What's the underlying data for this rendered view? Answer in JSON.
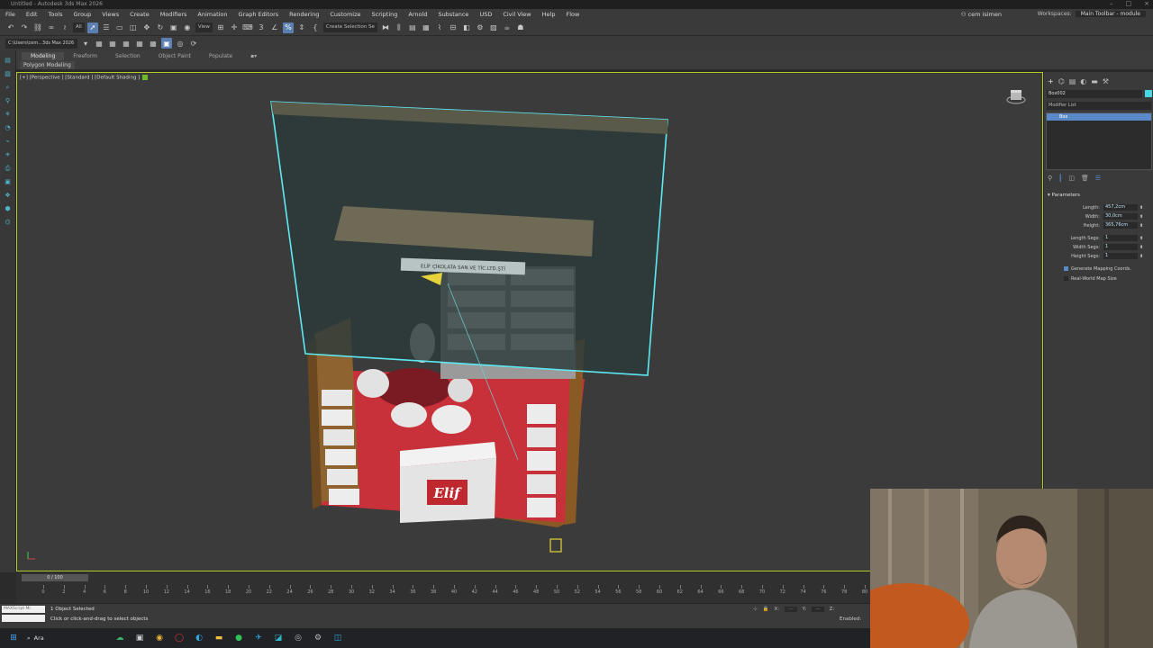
{
  "window": {
    "title": "Untitled - Autodesk 3ds Max 2026"
  },
  "menu": {
    "items": [
      "File",
      "Edit",
      "Tools",
      "Group",
      "Views",
      "Create",
      "Modifiers",
      "Animation",
      "Graph Editors",
      "Rendering",
      "Customize",
      "Scripting",
      "Arnold",
      "Substance",
      "USD",
      "Civil View",
      "Help",
      "Flow"
    ],
    "signin": "cem isimen",
    "workspace_label": "Workspaces:",
    "workspace_value": "Main Toolbar - module"
  },
  "toolbar": {
    "filter_value": "All",
    "view_value": "View",
    "selection_set_placeholder": "Create Selection Se"
  },
  "toolbar2": {
    "project_path": "C:\\Users\\cem...3ds Max 2026"
  },
  "ribbon": {
    "tabs": [
      "Modeling",
      "Freeform",
      "Selection",
      "Object Paint",
      "Populate"
    ],
    "sub_label": "Polygon Modeling"
  },
  "viewport": {
    "label": "[+] [Perspective ] [Standard ] [Default Shading ]",
    "sign_text": "ELİF ÇİKOLATA SAN.VE TİC.LTD.ŞTİ",
    "brand_text": "Elif"
  },
  "command_panel": {
    "object_name": "Box002",
    "modifier_list": "Modifier List",
    "stack_item": "Box",
    "rollout": "Parameters",
    "params": [
      {
        "label": "Length:",
        "value": "457,2cm"
      },
      {
        "label": "Width:",
        "value": "30,0cm"
      },
      {
        "label": "Height:",
        "value": "365,76cm"
      },
      {
        "label": "Length Segs:",
        "value": "1"
      },
      {
        "label": "Width Segs:",
        "value": "1"
      },
      {
        "label": "Height Segs:",
        "value": "1"
      }
    ],
    "gen_mapping": "Generate Mapping Coords.",
    "real_world": "Real-World Map Size"
  },
  "timeline": {
    "slider": "0 / 100",
    "ticks": [
      "0",
      "2",
      "4",
      "6",
      "8",
      "10",
      "12",
      "14",
      "16",
      "18",
      "20",
      "22",
      "24",
      "26",
      "28",
      "30",
      "32",
      "34",
      "36",
      "38",
      "40",
      "42",
      "44",
      "46",
      "48",
      "50",
      "52",
      "54",
      "56",
      "58",
      "60",
      "62",
      "64",
      "66",
      "68",
      "70",
      "72",
      "74",
      "76",
      "78",
      "80"
    ]
  },
  "status": {
    "maxscript": "MAXScript Mi",
    "selected": "1 Object Selected",
    "hint": "Click or click-and-drag to select objects",
    "x_label": "X:",
    "y_label": "Y:",
    "z_label": "Z:",
    "enabled": "Enabled:"
  },
  "taskbar": {
    "search": "Ara"
  },
  "colors": {
    "accent": "#5a89c8",
    "selection": "#5ee9f2",
    "carpet": "#c8303a",
    "wall": "#2c3b3a"
  }
}
